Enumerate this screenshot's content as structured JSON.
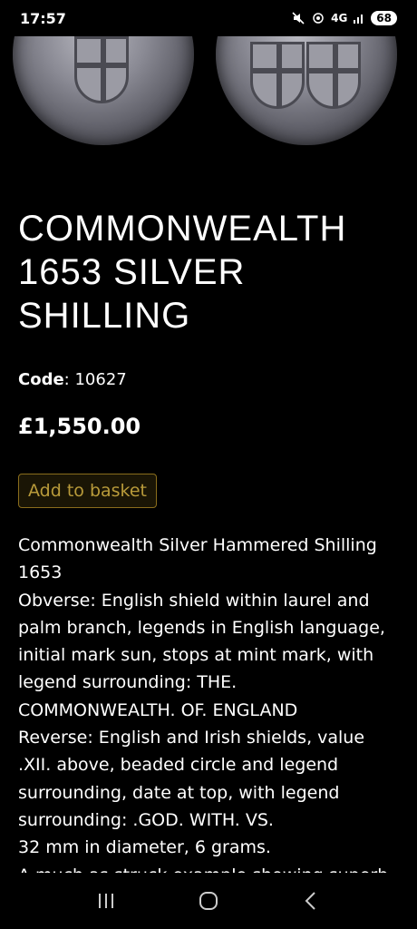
{
  "status_bar": {
    "time": "17:57",
    "network": "4G",
    "battery": "68"
  },
  "product": {
    "title": "COMMONWEALTH 1653 SILVER SHILLING",
    "code_label": "Code",
    "code_value": "10627",
    "price": "£1,550.00",
    "add_to_basket_label": "Add to basket",
    "description_lines": [
      "Commonwealth Silver Hammered Shilling 1653",
      "Obverse: English shield within laurel and palm branch, legends in English language, initial mark sun, stops at mint mark, with legend surrounding: THE. COMMONWEALTH. OF. ENGLAND",
      "Reverse: English and Irish shields, value .XII. above, beaded circle and legend surrounding, date at top, with legend surrounding: .GOD. WITH. VS.",
      "32 mm in diameter, 6 grams.",
      "A much as struck example showing superb"
    ]
  },
  "icons": {
    "mute": "mute-icon",
    "hotspot": "hotspot-icon",
    "signal": "signal-icon",
    "recents": "recents-icon",
    "home": "home-icon",
    "back": "back-icon"
  },
  "colors": {
    "background": "#000000",
    "button_border": "#8a6d1c",
    "button_text": "#b89a3a"
  }
}
